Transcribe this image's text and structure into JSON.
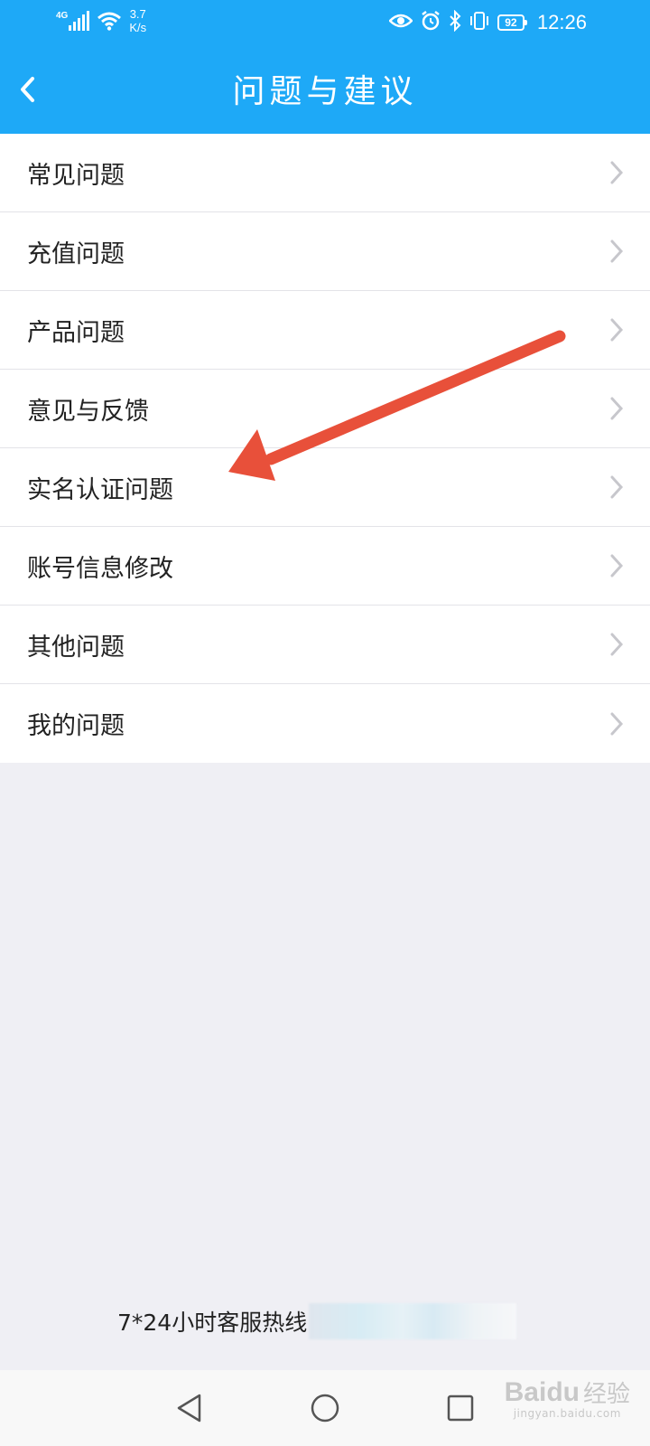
{
  "status_bar": {
    "network": "4G",
    "speed_value": "3.7",
    "speed_unit": "K/s",
    "battery": "92",
    "time": "12:26"
  },
  "header": {
    "title": "问题与建议"
  },
  "menu": {
    "items": [
      {
        "label": "常见问题"
      },
      {
        "label": "充值问题"
      },
      {
        "label": "产品问题"
      },
      {
        "label": "意见与反馈"
      },
      {
        "label": "实名认证问题"
      },
      {
        "label": "账号信息修改"
      },
      {
        "label": "其他问题"
      },
      {
        "label": "我的问题"
      }
    ]
  },
  "footer": {
    "hotline_label": "7*24小时客服热线"
  },
  "watermark": {
    "logo_text": "Baidu",
    "logo_cn": "经验",
    "url": "jingyan.baidu.com"
  },
  "colors": {
    "header_bg": "#1ea9f7",
    "page_bg": "#efeff4",
    "annotation_arrow": "#e8503a"
  },
  "icons": {
    "back": "chevron-left-icon",
    "row_arrow": "chevron-right-icon",
    "nav_back": "triangle-back-icon",
    "nav_home": "circle-home-icon",
    "nav_recents": "square-recents-icon"
  }
}
